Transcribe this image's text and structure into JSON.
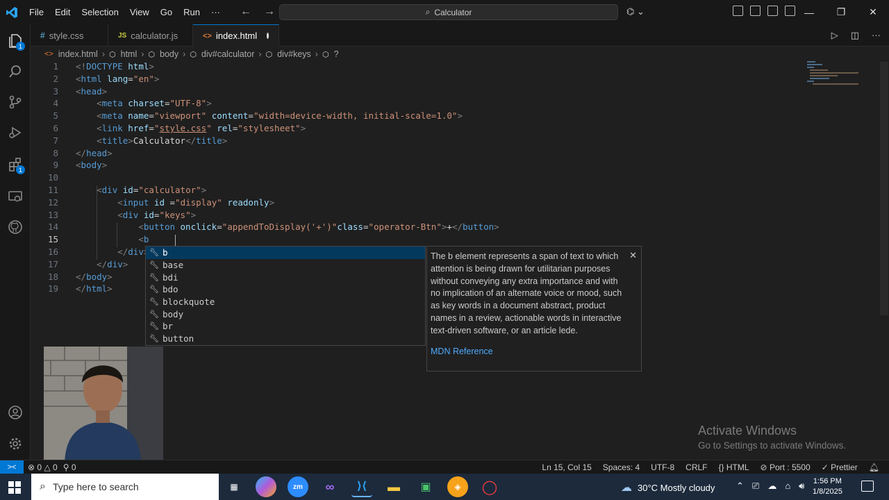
{
  "titlebar": {
    "menu": [
      "File",
      "Edit",
      "Selection",
      "View",
      "Go",
      "Run",
      "···"
    ],
    "search_text": "Calculator"
  },
  "tabs": [
    {
      "icon": "#",
      "label": "style.css",
      "active": false,
      "icon_color": "#519aba"
    },
    {
      "icon": "JS",
      "label": "calculator.js",
      "active": false,
      "icon_color": "#cbcb41"
    },
    {
      "icon": "<>",
      "label": "index.html",
      "active": true,
      "icon_color": "#e37933"
    }
  ],
  "breadcrumb": [
    "index.html",
    "html",
    "body",
    "div#calculator",
    "div#keys",
    "?"
  ],
  "code": [
    {
      "n": "1",
      "html": "<span class='br'>&lt;!</span><span class='t'>DOCTYPE</span> <span class='a'>html</span><span class='br'>&gt;</span>"
    },
    {
      "n": "2",
      "html": "<span class='br'>&lt;</span><span class='t'>html</span> <span class='a'>lang</span><span class='x'>=</span><span class='s'>\"en\"</span><span class='br'>&gt;</span>"
    },
    {
      "n": "3",
      "html": "<span class='br'>&lt;</span><span class='t'>head</span><span class='br'>&gt;</span>"
    },
    {
      "n": "4",
      "html": "    <span class='br'>&lt;</span><span class='t'>meta</span> <span class='a'>charset</span><span class='x'>=</span><span class='s'>\"UTF-8\"</span><span class='br'>&gt;</span>"
    },
    {
      "n": "5",
      "html": "    <span class='br'>&lt;</span><span class='t'>meta</span> <span class='a'>name</span><span class='x'>=</span><span class='s'>\"viewport\"</span> <span class='a'>content</span><span class='x'>=</span><span class='s'>\"width=device-width, initial-scale=1.0\"</span><span class='br'>&gt;</span>"
    },
    {
      "n": "6",
      "html": "    <span class='br'>&lt;</span><span class='t'>link</span> <span class='a'>href</span><span class='x'>=</span><span class='s'>\"<u>style.css</u>\"</span> <span class='a'>rel</span><span class='x'>=</span><span class='s'>\"stylesheet\"</span><span class='br'>&gt;</span>"
    },
    {
      "n": "7",
      "html": "    <span class='br'>&lt;</span><span class='t'>title</span><span class='br'>&gt;</span><span class='x'>Calculator</span><span class='br'>&lt;/</span><span class='t'>title</span><span class='br'>&gt;</span>"
    },
    {
      "n": "8",
      "html": "<span class='br'>&lt;/</span><span class='t'>head</span><span class='br'>&gt;</span>"
    },
    {
      "n": "9",
      "html": "<span class='br'>&lt;</span><span class='t'>body</span><span class='br'>&gt;</span>"
    },
    {
      "n": "10",
      "html": ""
    },
    {
      "n": "11",
      "html": "    <span class='br'>&lt;</span><span class='t'>div</span> <span class='a'>id</span><span class='x'>=</span><span class='s'>\"calculator\"</span><span class='br'>&gt;</span>"
    },
    {
      "n": "12",
      "html": "        <span class='br'>&lt;</span><span class='t'>input</span> <span class='a'>id</span> <span class='x'>=</span><span class='s'>\"display\"</span> <span class='a'>readonly</span><span class='br'>&gt;</span>"
    },
    {
      "n": "13",
      "html": "        <span class='br'>&lt;</span><span class='t'>div</span> <span class='a'>id</span><span class='x'>=</span><span class='s'>\"keys\"</span><span class='br'>&gt;</span>"
    },
    {
      "n": "14",
      "html": "            <span class='br'>&lt;</span><span class='t'>button</span> <span class='a'>onclick</span><span class='x'>=</span><span class='s'>\"appendToDisplay('+')\"</span><span class='a'>class</span><span class='x'>=</span><span class='s'>\"operator-Btn\"</span><span class='br'>&gt;</span><span class='x'>+</span><span class='br'>&lt;/</span><span class='t'>button</span><span class='br'>&gt;</span>"
    },
    {
      "n": "15",
      "html": "            <span class='br'>&lt;</span><span class='t'>b</span>"
    },
    {
      "n": "16",
      "html": "        <span class='br'>&lt;/</span><span class='t'>div</span><span class='br'>&gt;</span>"
    },
    {
      "n": "17",
      "html": "    <span class='br'>&lt;/</span><span class='t'>div</span><span class='br'>&gt;</span>"
    },
    {
      "n": "18",
      "html": "<span class='br'>&lt;/</span><span class='t'>body</span><span class='br'>&gt;</span>"
    },
    {
      "n": "19",
      "html": "<span class='br'>&lt;/</span><span class='t'>html</span><span class='br'>&gt;</span>"
    }
  ],
  "current_line": "15",
  "suggestions": [
    "b",
    "base",
    "bdi",
    "bdo",
    "blockquote",
    "body",
    "br",
    "button"
  ],
  "docs": {
    "text": "The b element represents a span of text to which attention is being drawn for utilitarian purposes without conveying any extra importance and with no implication of an alternate voice or mood, such as key words in a document abstract, product names in a review, actionable words in interactive text-driven software, or an article lede.",
    "link": "MDN Reference"
  },
  "activate": {
    "title": "Activate Windows",
    "subtitle": "Go to Settings to activate Windows."
  },
  "status": {
    "errors": "0",
    "warnings": "0",
    "ports": "0",
    "position": "Ln 15, Col 15",
    "spaces": "Spaces: 4",
    "encoding": "UTF-8",
    "eol": "CRLF",
    "language": "HTML",
    "port": "Port : 5500",
    "prettier": "Prettier"
  },
  "taskbar": {
    "search_placeholder": "Type here to search",
    "weather": "30°C  Mostly cloudy",
    "time": "1:56 PM",
    "date": "1/8/2025"
  },
  "colors": {
    "accent": "#0078d4",
    "taskbar": "#1c2a3c"
  }
}
